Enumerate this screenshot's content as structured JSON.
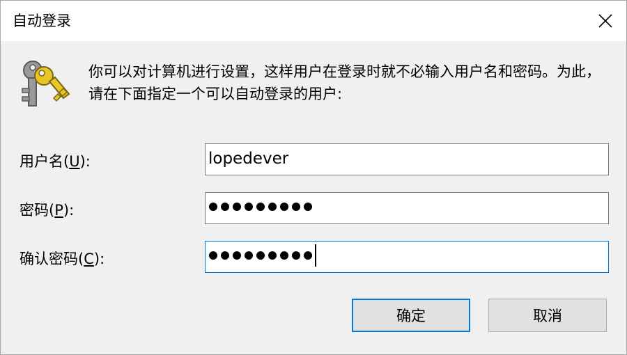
{
  "window": {
    "title": "自动登录",
    "close_icon": "close-icon"
  },
  "description": "你可以对计算机进行设置，这样用户在登录时就不必输入用户名和密码。为此，请在下面指定一个可以自动登录的用户:",
  "icon": "keys-icon",
  "form": {
    "username": {
      "label_prefix": "用户名(",
      "label_key": "U",
      "label_suffix": "):",
      "value": "lopedever"
    },
    "password": {
      "label_prefix": "密码(",
      "label_key": "P",
      "label_suffix": "):",
      "masked_count": 9
    },
    "confirm": {
      "label_prefix": "确认密码(",
      "label_key": "C",
      "label_suffix": "):",
      "masked_count": 9
    }
  },
  "buttons": {
    "ok_label": "确定",
    "cancel_label": "取消"
  },
  "colors": {
    "focus_border": "#0078d7",
    "key_gold": "#e6c628",
    "key_gray": "#8c8c8c"
  }
}
